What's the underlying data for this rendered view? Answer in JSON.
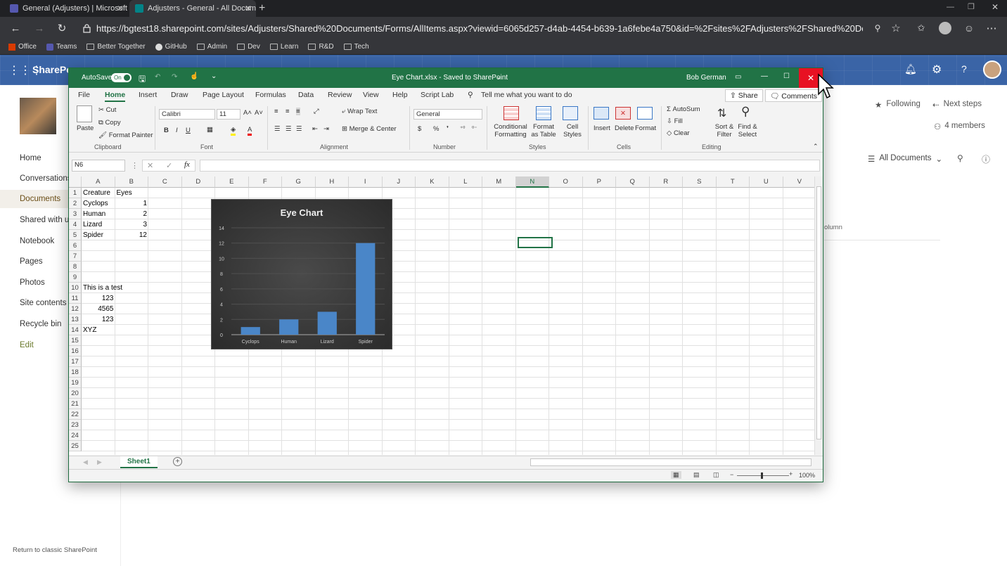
{
  "browser": {
    "tabs": [
      {
        "title": "General (Adjusters) | Microsoft T",
        "active": false,
        "icon_color": "#5558af"
      },
      {
        "title": "Adjusters - General - All Docume",
        "active": true,
        "icon_color": "#038387"
      }
    ],
    "url": "https://bgtest18.sharepoint.com/sites/Adjusters/Shared%20Documents/Forms/AllItems.aspx?viewid=6065d257-d4ab-4454-b639-1a6febe4a750&id=%2Fsites%2FAdjusters%2FShared%20Documents%2FGe...",
    "bookmarks": [
      "Office",
      "Teams",
      "Better Together",
      "GitHub",
      "Admin",
      "Dev",
      "Learn",
      "R&D",
      "Tech"
    ]
  },
  "sharepoint": {
    "app_name": "SharePo",
    "nav": [
      "Home",
      "Conversations",
      "Documents",
      "Shared with u",
      "Notebook",
      "Pages",
      "Photos",
      "Site contents",
      "Recycle bin",
      "Edit"
    ],
    "active_nav": "Documents",
    "following": "Following",
    "next_steps": "Next steps",
    "members": "4 members",
    "view": "All Documents",
    "column_fragment": "olumn",
    "footer_link": "Return to classic SharePoint"
  },
  "excel": {
    "autosave": "AutoSave",
    "autosave_state": "On",
    "doc_title": "Eye Chart.xlsx  -  Saved to SharePoint",
    "user": "Bob German",
    "ribbon_tabs": [
      "File",
      "Home",
      "Insert",
      "Draw",
      "Page Layout",
      "Formulas",
      "Data",
      "Review",
      "View",
      "Help",
      "Script Lab"
    ],
    "active_tab": "Home",
    "tell_me": "Tell me what you want to do",
    "share": "Share",
    "comments": "Comments",
    "clipboard": {
      "paste": "Paste",
      "cut": "Cut",
      "copy": "Copy",
      "format_painter": "Format Painter",
      "label": "Clipboard"
    },
    "font": {
      "name": "Calibri",
      "size": "11",
      "label": "Font"
    },
    "alignment": {
      "wrap": "Wrap Text",
      "merge": "Merge & Center",
      "label": "Alignment"
    },
    "number": {
      "format": "General",
      "label": "Number"
    },
    "styles": {
      "conditional": "Conditional Formatting",
      "table": "Format as Table",
      "cell": "Cell Styles",
      "label": "Styles"
    },
    "cells": {
      "insert": "Insert",
      "delete": "Delete",
      "format": "Format",
      "label": "Cells"
    },
    "editing": {
      "autosum": "AutoSum",
      "fill": "Fill",
      "clear": "Clear",
      "sort": "Sort & Filter",
      "find": "Find & Select",
      "label": "Editing"
    },
    "name_box": "N6",
    "columns": [
      "A",
      "B",
      "C",
      "D",
      "E",
      "F",
      "G",
      "H",
      "I",
      "J",
      "K",
      "L",
      "M",
      "N",
      "O",
      "P",
      "Q",
      "R",
      "S",
      "T",
      "U",
      "V"
    ],
    "cells_data": [
      {
        "row": 1,
        "col": 0,
        "v": "Creature"
      },
      {
        "row": 1,
        "col": 1,
        "v": "Eyes"
      },
      {
        "row": 2,
        "col": 0,
        "v": "Cyclops"
      },
      {
        "row": 2,
        "col": 1,
        "v": "1",
        "num": true
      },
      {
        "row": 3,
        "col": 0,
        "v": "Human"
      },
      {
        "row": 3,
        "col": 1,
        "v": "2",
        "num": true
      },
      {
        "row": 4,
        "col": 0,
        "v": "Lizard"
      },
      {
        "row": 4,
        "col": 1,
        "v": "3",
        "num": true
      },
      {
        "row": 5,
        "col": 0,
        "v": "Spider"
      },
      {
        "row": 5,
        "col": 1,
        "v": "12",
        "num": true
      },
      {
        "row": 10,
        "col": 0,
        "v": "This is a test"
      },
      {
        "row": 11,
        "col": 0,
        "v": "123",
        "num": true
      },
      {
        "row": 12,
        "col": 0,
        "v": "4565",
        "num": true
      },
      {
        "row": 13,
        "col": 0,
        "v": "123",
        "num": true
      },
      {
        "row": 14,
        "col": 0,
        "v": "XYZ"
      }
    ],
    "rows_visible": 25,
    "sheet_tab": "Sheet1",
    "zoom": "100%"
  },
  "chart_data": {
    "type": "bar",
    "title": "Eye Chart",
    "categories": [
      "Cyclops",
      "Human",
      "Lizard",
      "Spider"
    ],
    "values": [
      1,
      2,
      3,
      12
    ],
    "ylim": [
      0,
      14
    ],
    "yticks": [
      0,
      2,
      4,
      6,
      8,
      10,
      12,
      14
    ],
    "bar_color": "#4a86c8",
    "grid": true,
    "background": "dark"
  }
}
